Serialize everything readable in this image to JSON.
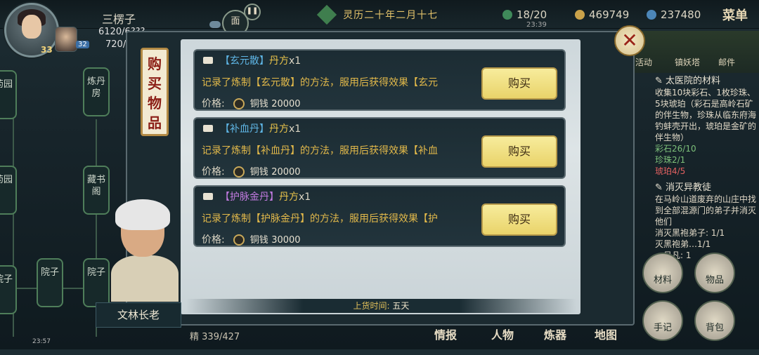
{
  "player": {
    "name": "三楞子",
    "level": "33",
    "hp": "6120/6???",
    "mp": "720/7??",
    "companion_level": "32"
  },
  "topbar": {
    "menu_icon": "面",
    "pause_icon": "pause-icon",
    "date": "灵历二十年二月十七",
    "stamina": "18/20",
    "time": "23:39",
    "copper": "469749",
    "jade": "237480",
    "menu_label": "菜单"
  },
  "map": {
    "nodes": [
      "药园",
      "炼丹房",
      "药园",
      "藏书阁",
      "院子",
      "院子",
      "院子"
    ]
  },
  "shop": {
    "title": "购买物品",
    "items": [
      {
        "bracket_open": "【",
        "name": "玄元散",
        "bracket_close": "】",
        "kind": "丹方",
        "qty": "x1",
        "desc": "记录了炼制【玄元散】的方法，服用后获得效果【玄元",
        "price_label": "价格:",
        "currency": "铜钱",
        "price": "20000",
        "buy_label": "购买"
      },
      {
        "bracket_open": "【",
        "name": "补血丹",
        "bracket_close": "】",
        "kind": "丹方",
        "qty": "x1",
        "desc": "记录了炼制【补血丹】的方法，服用后获得效果【补血",
        "price_label": "价格:",
        "currency": "铜钱",
        "price": "20000",
        "buy_label": "购买"
      },
      {
        "bracket_open": "【",
        "name": "护脉金丹",
        "bracket_close": "】",
        "kind": "丹方",
        "qty": "x1",
        "desc": "记录了炼制【护脉金丹】的方法，服用后获得效果【护",
        "price_label": "价格:",
        "currency": "铜钱",
        "price": "30000",
        "buy_label": "购买"
      }
    ],
    "restock_label": "上货时间:",
    "restock_value": "五天",
    "close_icon": "close-icon"
  },
  "npc": {
    "name": "文林长老"
  },
  "right": {
    "icons": [
      "活动",
      "镇妖塔",
      "邮件"
    ],
    "quest1": {
      "title": "太医院的材料",
      "desc": "收集10块彩石、1枚珍珠、5块琥珀（彩石是高岭石矿的伴生物，珍珠从临东府海钓蚌壳开出，琥珀是金矿的伴生物）",
      "progress": [
        "彩石26/10",
        "珍珠2/1",
        "琥珀4/5"
      ]
    },
    "quest2": {
      "title": "消灭异教徒",
      "desc": "在马岭山道废弃的山庄中找到全部混源门的弟子并消灭他们",
      "progress": [
        "消灭黑袍弟子: 1/1",
        "灭黑袍弟…1/1",
        "…吕凡: 1"
      ]
    },
    "buttons": [
      "材料",
      "物品"
    ],
    "bottom_buttons": [
      "手记",
      "背包"
    ]
  },
  "bottom": {
    "tabs": [
      "情报",
      "人物",
      "炼器",
      "地图"
    ],
    "exp": "339/427",
    "exp_label": "精",
    "sys_time": "23:57"
  }
}
